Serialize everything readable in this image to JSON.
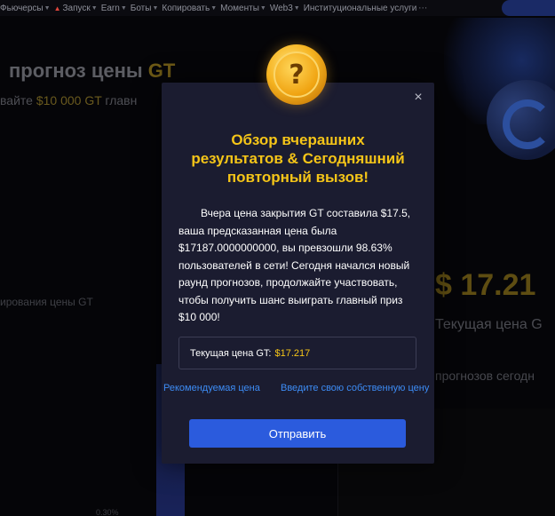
{
  "topnav": {
    "items": [
      "Фьючерсы",
      "Запуск",
      "Earn",
      "Боты",
      "Копировать",
      "Моменты",
      "Web3",
      "Институциональные услуги"
    ],
    "more_icon": "ellipsis-icon"
  },
  "background": {
    "title_prefix": "прогноз цены",
    "title_token": "GT",
    "subtitle_prefix": "вайте",
    "subtitle_amount": "$10 000 GT",
    "subtitle_suffix": "главн",
    "chart_label": "ирования цены GT",
    "price": "$ 17.21",
    "current_label": "Текущая цена G",
    "forecast_label": "прогнозов сегодн",
    "pct": "0.30%"
  },
  "modal": {
    "heading_line1": "Обзор вчерашних",
    "heading_line2": "результатов & Сегодняшний",
    "heading_line3": "повторный вызов!",
    "body": "Вчера цена закрытия GT составила $17.5, ваша предсказанная цена была $17187.0000000000, вы превзошли 98.63% пользователей в сети! Сегодня начался новый раунд прогнозов, продолжайте участвовать, чтобы получить шанс выиграть главный приз $10 000!",
    "price_label": "Текущая цена GT:",
    "price_value": "$17.217",
    "link_recommended": "Рекомендуемая цена",
    "link_own": "Введите свою собственную цену",
    "submit_label": "Отправить",
    "close_symbol": "×",
    "medal_symbol": "?"
  },
  "colors": {
    "accent_gold": "#f5c518",
    "link_blue": "#3d8cf5",
    "button_blue": "#2b5bdd",
    "modal_bg": "#1b1c30"
  }
}
